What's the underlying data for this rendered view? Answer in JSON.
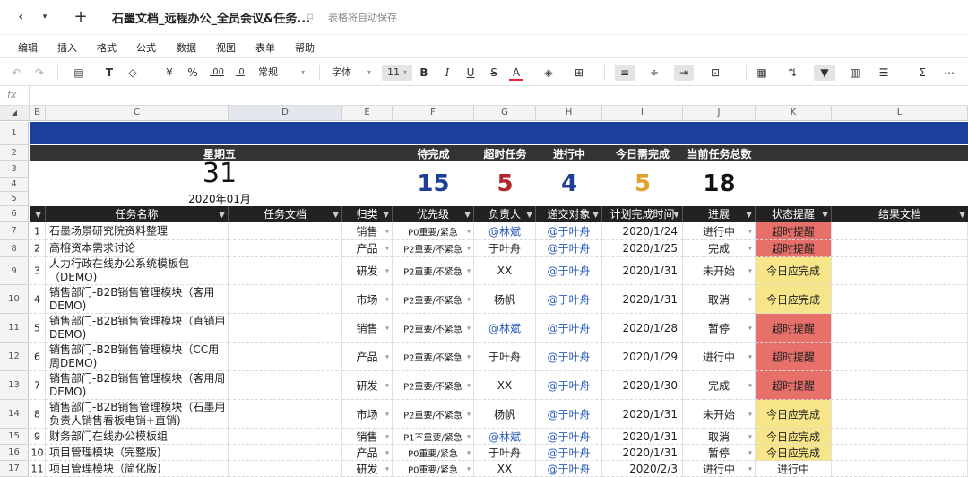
{
  "titlebar": {
    "back_icon": "chevron-left-icon",
    "dropdown_icon": "caret-down-icon",
    "new_icon": "plus-icon",
    "doc_title": "石墨文档_远程办公_全员会议&任务...",
    "bookmark_icon": "bookmark-icon",
    "autosave": "表格将自动保存"
  },
  "menu": [
    "编辑",
    "插入",
    "格式",
    "公式",
    "数据",
    "视图",
    "表单",
    "帮助"
  ],
  "toolbar": {
    "currency": "¥",
    "percent": "%",
    "dec_add": ".00",
    "dec_sub": ".0",
    "format": "常规",
    "font": "字体",
    "font_size": "11",
    "bold": "B",
    "italic": "I",
    "underline": "U",
    "strike": "S",
    "text_color": "A",
    "sum": "Σ"
  },
  "formula_bar": {
    "fx": "fx",
    "value": ""
  },
  "columns": [
    "B",
    "C",
    "D",
    "E",
    "F",
    "G",
    "H",
    "I",
    "J",
    "K",
    "L"
  ],
  "rows": [
    "1",
    "2",
    "3",
    "4",
    "5",
    "6",
    "7",
    "8",
    "9",
    "10",
    "11",
    "12",
    "13",
    "14",
    "15",
    "16",
    "17"
  ],
  "dashboard": {
    "weekday": "星期五",
    "day": "31",
    "month": "2020年01月",
    "stats": [
      {
        "label": "待完成",
        "value": "15",
        "color": "#1d3f96"
      },
      {
        "label": "超时任务",
        "value": "5",
        "color": "#b0262c"
      },
      {
        "label": "进行中",
        "value": "4",
        "color": "#1d3f96"
      },
      {
        "label": "今日需完成",
        "value": "5",
        "color": "#e0a329"
      },
      {
        "label": "当前任务总数",
        "value": "18",
        "color": "#111111"
      }
    ]
  },
  "table": {
    "headers": [
      "任务名称",
      "任务文档",
      "归类",
      "优先级",
      "负责人",
      "递交对象",
      "计划完成时间",
      "进展",
      "状态提醒",
      "结果文档"
    ],
    "rows": [
      {
        "n": "1",
        "task": "石墨场景研究院资料整理",
        "cat": "销售",
        "pri": "P0重要/紧急",
        "owner": "@林斌",
        "owner_mention": true,
        "to": "@于叶舟",
        "date": "2020/1/24",
        "prog": "进行中",
        "status": "超时提醒",
        "status_type": "red"
      },
      {
        "n": "2",
        "task": "高榕资本需求讨论",
        "cat": "产品",
        "pri": "P2重要/不紧急",
        "owner": "于叶舟",
        "owner_mention": false,
        "to": "@于叶舟",
        "date": "2020/1/25",
        "prog": "完成",
        "status": "超时提醒",
        "status_type": "red"
      },
      {
        "n": "3",
        "task": "人力行政在线办公系统模板包（DEMO)",
        "cat": "研发",
        "pri": "P2重要/不紧急",
        "owner": "XX",
        "owner_mention": false,
        "to": "@于叶舟",
        "date": "2020/1/31",
        "prog": "未开始",
        "status": "今日应完成",
        "status_type": "yellow"
      },
      {
        "n": "4",
        "task": "销售部门-B2B销售管理模块（客用DEMO)",
        "cat": "市场",
        "pri": "P2重要/不紧急",
        "owner": "杨帆",
        "owner_mention": false,
        "to": "@于叶舟",
        "date": "2020/1/31",
        "prog": "取消",
        "status": "今日应完成",
        "status_type": "yellow"
      },
      {
        "n": "5",
        "task": "销售部门-B2B销售管理模块（直销用DEMO)",
        "cat": "销售",
        "pri": "P2重要/不紧急",
        "owner": "@林斌",
        "owner_mention": true,
        "to": "@于叶舟",
        "date": "2020/1/28",
        "prog": "暂停",
        "status": "超时提醒",
        "status_type": "red"
      },
      {
        "n": "6",
        "task": "销售部门-B2B销售管理模块（CC用周DEMO)",
        "cat": "产品",
        "pri": "P2重要/不紧急",
        "owner": "于叶舟",
        "owner_mention": false,
        "to": "@于叶舟",
        "date": "2020/1/29",
        "prog": "进行中",
        "status": "超时提醒",
        "status_type": "red"
      },
      {
        "n": "7",
        "task": "销售部门-B2B销售管理模块（客用周DEMO)",
        "cat": "研发",
        "pri": "P2重要/不紧急",
        "owner": "XX",
        "owner_mention": false,
        "to": "@于叶舟",
        "date": "2020/1/30",
        "prog": "完成",
        "status": "超时提醒",
        "status_type": "red"
      },
      {
        "n": "8",
        "task": "销售部门-B2B销售管理模块（石墨用负责人销售看板电销+直销)",
        "cat": "市场",
        "pri": "P2重要/不紧急",
        "owner": "杨帆",
        "owner_mention": false,
        "to": "@于叶舟",
        "date": "2020/1/31",
        "prog": "未开始",
        "status": "今日应完成",
        "status_type": "yellow"
      },
      {
        "n": "9",
        "task": "财务部门在线办公模板组",
        "cat": "销售",
        "pri": "P1不重要/紧急",
        "owner": "@林斌",
        "owner_mention": true,
        "to": "@于叶舟",
        "date": "2020/1/31",
        "prog": "取消",
        "status": "今日应完成",
        "status_type": "yellow"
      },
      {
        "n": "10",
        "task": "项目管理模块（完整版)",
        "cat": "产品",
        "pri": "P0重要/紧急",
        "owner": "于叶舟",
        "owner_mention": false,
        "to": "@于叶舟",
        "date": "2020/1/31",
        "prog": "暂停",
        "status": "今日应完成",
        "status_type": "yellow"
      },
      {
        "n": "11",
        "task": "项目管理模块（简化版)",
        "cat": "研发",
        "pri": "P0重要/紧急",
        "owner": "XX",
        "owner_mention": false,
        "to": "@于叶舟",
        "date": "2020/2/3",
        "prog": "进行中",
        "status": "进行中",
        "status_type": "plain"
      }
    ]
  }
}
